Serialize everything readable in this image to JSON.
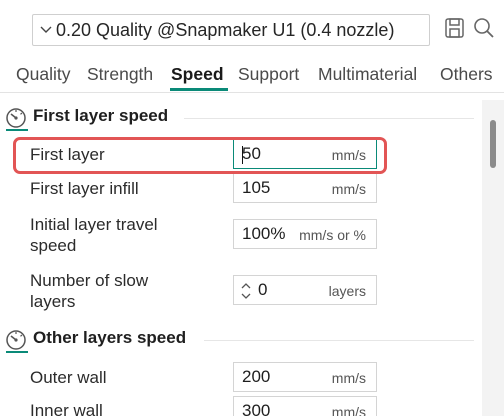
{
  "preset": {
    "name": "0.20 Quality @Snapmaker U1 (0.4 nozzle)",
    "chevron_icon": "chevron-down-icon",
    "save_icon": "save-icon",
    "search_icon": "search-icon"
  },
  "tabs": [
    {
      "label": "Quality",
      "active": false
    },
    {
      "label": "Strength",
      "active": false
    },
    {
      "label": "Speed",
      "active": true
    },
    {
      "label": "Support",
      "active": false
    },
    {
      "label": "Multimaterial",
      "active": false
    },
    {
      "label": "Others",
      "active": false
    }
  ],
  "sections": [
    {
      "title": "First layer speed",
      "icon": "speedometer-icon",
      "rows": [
        {
          "label": "First layer",
          "value": "50",
          "unit": "mm/s",
          "focused": true
        },
        {
          "label": "First layer infill",
          "value": "105",
          "unit": "mm/s"
        },
        {
          "label_line1": "Initial layer travel",
          "label_line2": "speed",
          "value": "100%",
          "unit": "mm/s or %"
        },
        {
          "label_line1": "Number of slow",
          "label_line2": "layers",
          "value": "0",
          "unit": "layers"
        }
      ]
    },
    {
      "title": "Other layers speed",
      "icon": "speedometer-icon",
      "rows": [
        {
          "label": "Outer wall",
          "value": "200",
          "unit": "mm/s"
        },
        {
          "label": "Inner wall",
          "value": "300",
          "unit": "mm/s"
        }
      ]
    }
  ],
  "colors": {
    "accent": "#0a8a78",
    "highlight": "#e25555"
  }
}
